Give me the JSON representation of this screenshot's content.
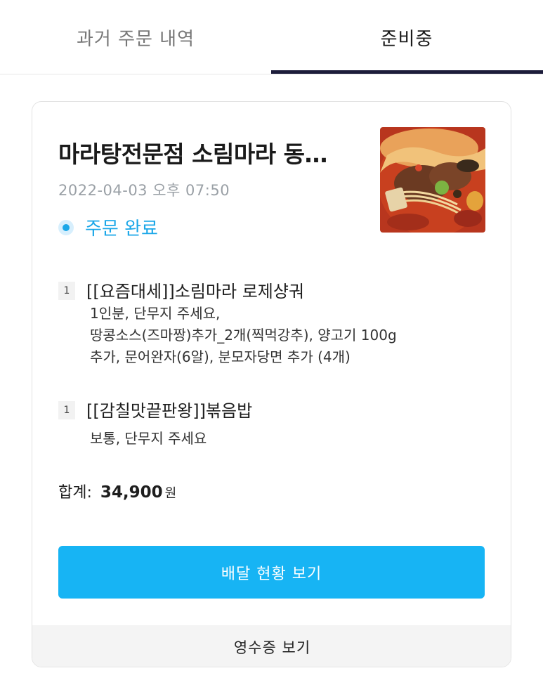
{
  "tabs": {
    "past_label": "과거 주문 내역",
    "active_label": "준비중"
  },
  "order": {
    "store_name": "마라탕전문점 소림마라 동…",
    "date": "2022-04-03 오후 07:50",
    "status": "주문 완료",
    "items": [
      {
        "qty": "1",
        "name": "[[요즘대세]]소림마라 로제샹궈",
        "options": "1인분, 단무지 주세요,\n땅콩소스(즈마짱)추가_2개(찍먹강추), 양고기 100g\n추가, 문어완자(6알), 분모자당면 추가 (4개)"
      },
      {
        "qty": "1",
        "name": "[[감칠맛끝판왕]]볶음밥",
        "options": "보통, 단무지 주세요"
      }
    ],
    "total_label": "합계:",
    "total_amount": "34,900",
    "total_unit": "원"
  },
  "actions": {
    "delivery_status": "배달 현황 보기",
    "receipt": "영수증 보기"
  },
  "colors": {
    "accent": "#17b4f4",
    "status": "#1ba7e8",
    "tab_indicator": "#1c1c3a"
  }
}
